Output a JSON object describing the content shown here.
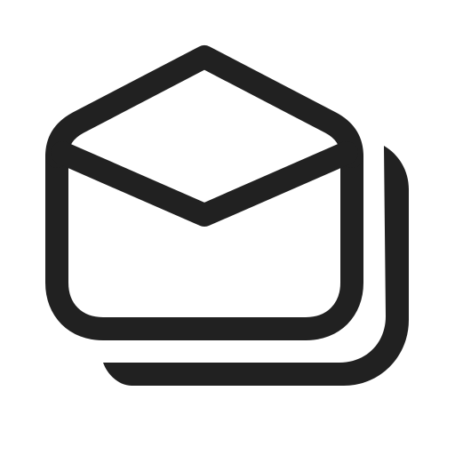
{
  "icon": {
    "name": "mail-read-multiple-icon",
    "color": "#212121"
  }
}
